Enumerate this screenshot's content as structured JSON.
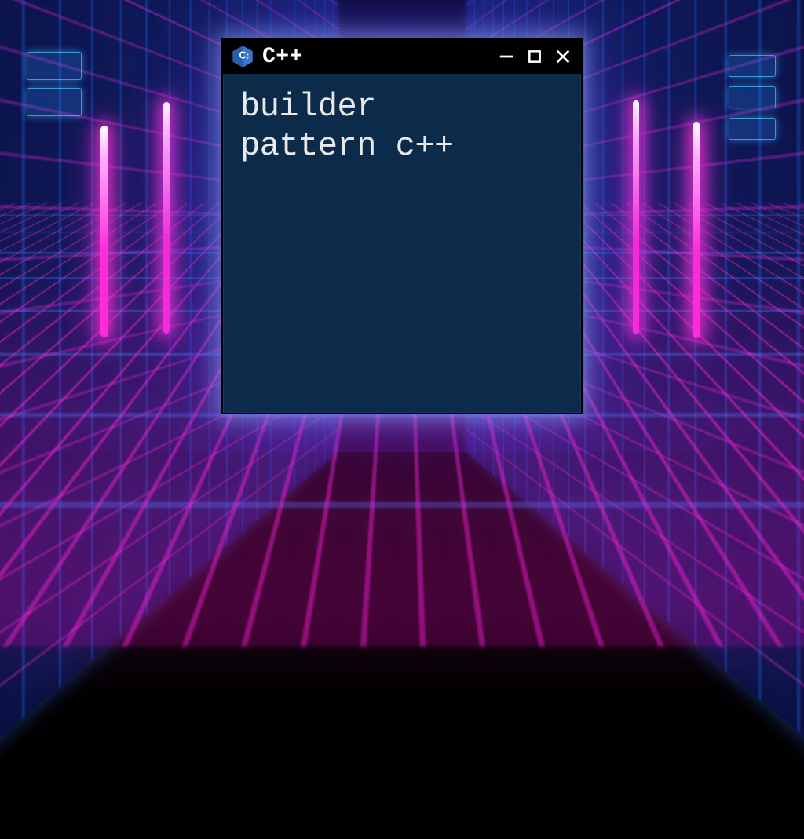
{
  "window": {
    "title": "C++",
    "content_text": "builder\npattern c++",
    "icon": "cpp-logo-icon",
    "controls": {
      "minimize": "minimize",
      "maximize": "maximize",
      "close": "close"
    }
  },
  "colors": {
    "window_bg": "#0c2b4a",
    "titlebar_bg": "#000000",
    "text": "#e9e9e9",
    "neon_pink": "#ff2ad8",
    "neon_blue": "#2a8cff"
  }
}
